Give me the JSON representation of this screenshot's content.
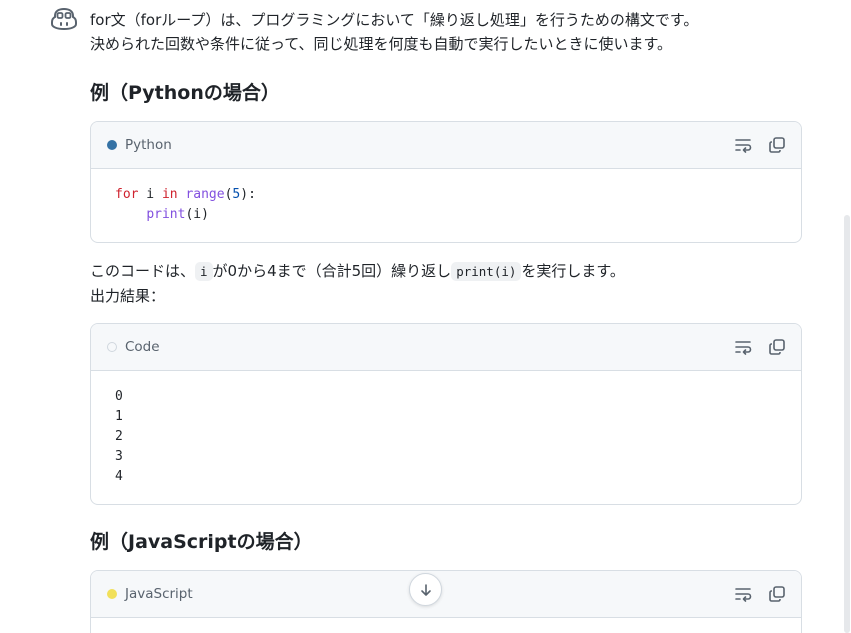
{
  "intro": {
    "line1": "for文（forループ）は、プログラミングにおいて「繰り返し処理」を行うための構文です。",
    "line2": "決められた回数や条件に従って、同じ処理を何度も自動で実行したいときに使います。"
  },
  "section_python": {
    "heading": "例（Pythonの場合）"
  },
  "python_block": {
    "language": "Python",
    "dot_color": "#3572A5",
    "code": {
      "kw_for": "for",
      "var_i": " i ",
      "kw_in": "in",
      "fn_range": "range",
      "paren_open": "(",
      "num_5": "5",
      "paren_close_colon": "):",
      "indent": "    ",
      "fn_print": "print",
      "print_args": "(i)"
    }
  },
  "explain": {
    "part1": "このコードは、",
    "code_i": "i",
    "part2": "が0から4まで（合計5回）繰り返し",
    "code_print": "print(i)",
    "part3": "を実行します。",
    "line2": "出力結果："
  },
  "output_block": {
    "language": "Code",
    "lines": [
      "0",
      "1",
      "2",
      "3",
      "4"
    ]
  },
  "section_js": {
    "heading": "例（JavaScriptの場合）"
  },
  "js_block": {
    "language": "JavaScript",
    "dot_color": "#f1e05a"
  },
  "icons": {
    "wrap": "wrap-lines-icon",
    "copy": "copy-icon",
    "scroll": "arrow-down-icon",
    "avatar": "copilot-icon"
  }
}
